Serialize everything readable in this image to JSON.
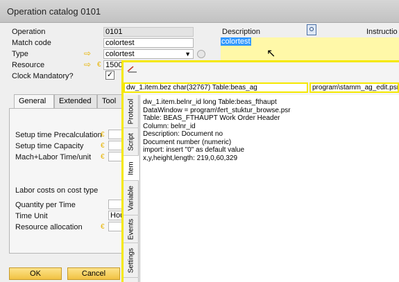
{
  "window": {
    "title": "Operation catalog 0101"
  },
  "form": {
    "operation": {
      "label": "Operation",
      "value": "0101"
    },
    "match_code": {
      "label": "Match code",
      "value": "colortest"
    },
    "type": {
      "label": "Type",
      "value": "colortest"
    },
    "resource": {
      "label": "Resource",
      "value": "1500"
    },
    "clock_mandatory": {
      "label": "Clock Mandatory?",
      "checked": true
    },
    "description": {
      "label": "Description",
      "value": "colortest"
    },
    "instructions": {
      "label": "Instructio"
    }
  },
  "tabs": [
    {
      "label": "General",
      "active": true
    },
    {
      "label": "Extended",
      "active": false
    },
    {
      "label": "Tool",
      "active": false
    }
  ],
  "general": {
    "setup_precalc": "Setup time Precalculation",
    "setup_capacity": "Setup time Capacity",
    "mach_labor": "Mach+Labor Time/unit",
    "labor_costs": "Labor costs on cost type",
    "qty_per_time": "Quantity per Time",
    "time_unit": "Time Unit",
    "time_unit_value": "Hou",
    "resource_alloc": "Resource allocation"
  },
  "buttons": {
    "ok": "OK",
    "cancel": "Cancel"
  },
  "popup": {
    "field_info": "dw_1.item.bez char(32767) Table:beas_ag",
    "path": "program\\stamm_ag_edit.psr",
    "vtabs": [
      "Protocol",
      "Script",
      "Item",
      "Variable",
      "Events",
      "Settings"
    ],
    "active_vtab": "Item",
    "lines": [
      "dw_1.item.belnr_id long Table:beas_fthaupt",
      "DataWindow = program\\fert_stuktur_browse.psr",
      "Table: BEAS_FTHAUPT Work Order  Header",
      "Column: belnr_id",
      "Description: Document no",
      "Document number (numeric)",
      "import: insert \"0\" as default value",
      "x,y,height,length: 219,0,60,329"
    ]
  },
  "colors": {
    "highlight": "#f5e800",
    "selection": "#3399ff",
    "button": "#f1c243"
  }
}
